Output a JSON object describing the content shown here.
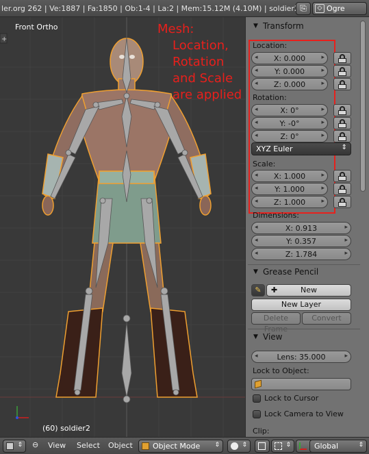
{
  "topbar": {
    "info": "ler.org 262 | Ve:1887 | Fa:1850 | Ob:1-4 | La:2 | Mem:15.12M (4.10M) | soldier2",
    "scene_name": "Ogre"
  },
  "viewport": {
    "view_label": "Front Ortho",
    "object_label": "(60) soldier2"
  },
  "annotation": {
    "line1": "Mesh:",
    "line2": "Location,",
    "line3": "Rotation",
    "line4": "and Scale",
    "line5": "are applied"
  },
  "transform": {
    "header": "Transform",
    "location_label": "Location:",
    "location": [
      "X: 0.000",
      "Y: 0.000",
      "Z: 0.000"
    ],
    "rotation_label": "Rotation:",
    "rotation": [
      "X: 0°",
      "Y: -0°",
      "Z: 0°"
    ],
    "rotation_mode": "XYZ Euler",
    "scale_label": "Scale:",
    "scale": [
      "X: 1.000",
      "Y: 1.000",
      "Z: 1.000"
    ],
    "dimensions_label": "Dimensions:",
    "dimensions": [
      "X: 0.913",
      "Y: 0.357",
      "Z: 1.784"
    ]
  },
  "grease_pencil": {
    "header": "Grease Pencil",
    "new_label": "New",
    "new_layer_label": "New Layer",
    "delete_frame_label": "Delete Frame",
    "convert_label": "Convert"
  },
  "view": {
    "header": "View",
    "lens": "Lens: 35.000",
    "lock_to_object_label": "Lock to Object:",
    "lock_to_cursor_label": "Lock to Cursor",
    "lock_camera_label": "Lock Camera to View",
    "clip_label": "Clip:"
  },
  "bottombar": {
    "view_menu": "View",
    "select_menu": "Select",
    "object_menu": "Object",
    "mode": "Object Mode",
    "orientation": "Global"
  },
  "colors": {
    "annotation_red": "#e8201c",
    "panel_bg": "#727272",
    "viewport_bg": "#393939"
  }
}
